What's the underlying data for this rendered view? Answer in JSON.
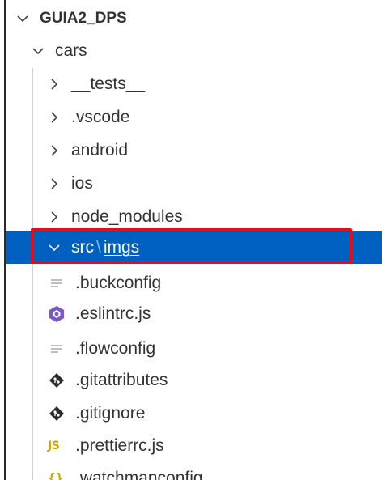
{
  "explorer": {
    "root": {
      "label": "GUIA2_DPS",
      "expanded": true
    },
    "folder": {
      "label": "cars",
      "expanded": true
    },
    "children": [
      {
        "label": "__tests__",
        "type": "folder",
        "expanded": false
      },
      {
        "label": ".vscode",
        "type": "folder",
        "expanded": false
      },
      {
        "label": "android",
        "type": "folder",
        "expanded": false
      },
      {
        "label": "ios",
        "type": "folder",
        "expanded": false
      },
      {
        "label": "node_modules",
        "type": "folder",
        "expanded": false
      }
    ],
    "selected": {
      "segment1": "src",
      "separator": "\\",
      "segment2": "imgs",
      "expanded": true
    },
    "files": [
      {
        "label": ".buckconfig",
        "icon": "lines-file-icon"
      },
      {
        "label": ".eslintrc.js",
        "icon": "eslint-icon"
      },
      {
        "label": ".flowconfig",
        "icon": "lines-file-icon"
      },
      {
        "label": ".gitattributes",
        "icon": "git-icon"
      },
      {
        "label": ".gitignore",
        "icon": "git-icon"
      },
      {
        "label": ".prettierrc.js",
        "icon": "js-icon",
        "icon_text": "JS"
      },
      {
        "label": ".watchmanconfig",
        "icon": "braces-icon",
        "icon_text": "{}"
      }
    ]
  },
  "colors": {
    "selection": "#0060c0",
    "highlight_border": "#e0101a",
    "eslint": "#7a57c8",
    "js_badge": "#c8a800"
  }
}
